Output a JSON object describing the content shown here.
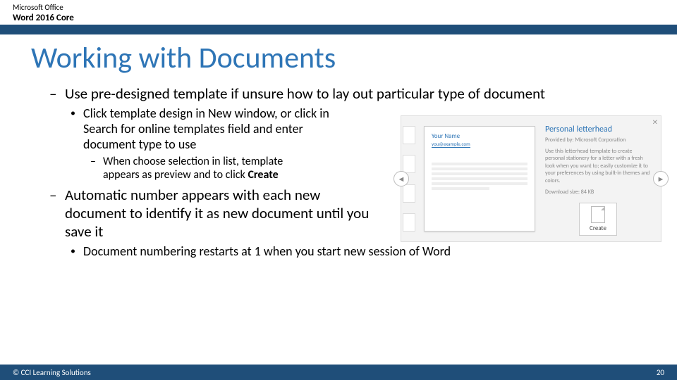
{
  "header": {
    "suite": "Microsoft Office",
    "product": "Word 2016 Core"
  },
  "title": "Working with Documents",
  "bullets": {
    "l1a": "Use pre-designed template if unsure how to lay out particular type of document",
    "l2a": "Click template design in New window, or click in Search for online templates field and enter document type to use",
    "l3a_pre": "When choose selection in list, template appears as preview and to click ",
    "l3a_strong": "Create",
    "l1b": "Automatic number appears with each new document to identify it as new document until you save it",
    "l2b": "Document numbering restarts at 1 when you start new session of Word"
  },
  "illus": {
    "close": "✕",
    "preview_name": "Your Name",
    "preview_email": "you@example.com",
    "info_title": "Personal letterhead",
    "info_by": "Provided by: Microsoft Corporation",
    "info_desc": "Use this letterhead template to create personal stationery for a letter with a fresh look when you want to; easily customize it to your preferences by using built-in themes and colors.",
    "info_size": "Download size: 84 KB",
    "create_label": "Create",
    "nav_left": "◄",
    "nav_right": "►"
  },
  "footer": {
    "copyright": "© CCI Learning Solutions",
    "page": "20"
  }
}
